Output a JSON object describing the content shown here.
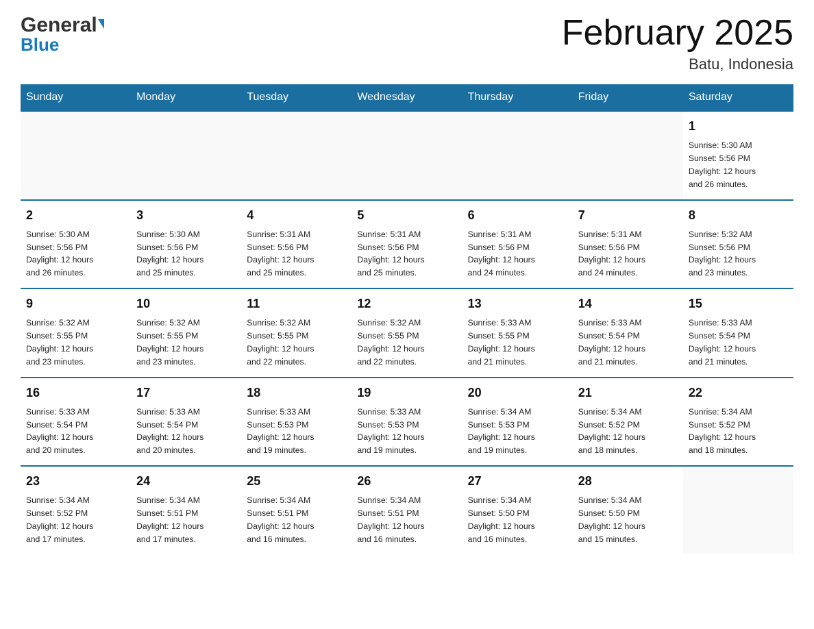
{
  "header": {
    "logo_general": "General",
    "logo_blue": "Blue",
    "month_title": "February 2025",
    "location": "Batu, Indonesia"
  },
  "weekdays": [
    "Sunday",
    "Monday",
    "Tuesday",
    "Wednesday",
    "Thursday",
    "Friday",
    "Saturday"
  ],
  "weeks": [
    [
      {
        "day": "",
        "info": ""
      },
      {
        "day": "",
        "info": ""
      },
      {
        "day": "",
        "info": ""
      },
      {
        "day": "",
        "info": ""
      },
      {
        "day": "",
        "info": ""
      },
      {
        "day": "",
        "info": ""
      },
      {
        "day": "1",
        "info": "Sunrise: 5:30 AM\nSunset: 5:56 PM\nDaylight: 12 hours\nand 26 minutes."
      }
    ],
    [
      {
        "day": "2",
        "info": "Sunrise: 5:30 AM\nSunset: 5:56 PM\nDaylight: 12 hours\nand 26 minutes."
      },
      {
        "day": "3",
        "info": "Sunrise: 5:30 AM\nSunset: 5:56 PM\nDaylight: 12 hours\nand 25 minutes."
      },
      {
        "day": "4",
        "info": "Sunrise: 5:31 AM\nSunset: 5:56 PM\nDaylight: 12 hours\nand 25 minutes."
      },
      {
        "day": "5",
        "info": "Sunrise: 5:31 AM\nSunset: 5:56 PM\nDaylight: 12 hours\nand 25 minutes."
      },
      {
        "day": "6",
        "info": "Sunrise: 5:31 AM\nSunset: 5:56 PM\nDaylight: 12 hours\nand 24 minutes."
      },
      {
        "day": "7",
        "info": "Sunrise: 5:31 AM\nSunset: 5:56 PM\nDaylight: 12 hours\nand 24 minutes."
      },
      {
        "day": "8",
        "info": "Sunrise: 5:32 AM\nSunset: 5:56 PM\nDaylight: 12 hours\nand 23 minutes."
      }
    ],
    [
      {
        "day": "9",
        "info": "Sunrise: 5:32 AM\nSunset: 5:55 PM\nDaylight: 12 hours\nand 23 minutes."
      },
      {
        "day": "10",
        "info": "Sunrise: 5:32 AM\nSunset: 5:55 PM\nDaylight: 12 hours\nand 23 minutes."
      },
      {
        "day": "11",
        "info": "Sunrise: 5:32 AM\nSunset: 5:55 PM\nDaylight: 12 hours\nand 22 minutes."
      },
      {
        "day": "12",
        "info": "Sunrise: 5:32 AM\nSunset: 5:55 PM\nDaylight: 12 hours\nand 22 minutes."
      },
      {
        "day": "13",
        "info": "Sunrise: 5:33 AM\nSunset: 5:55 PM\nDaylight: 12 hours\nand 21 minutes."
      },
      {
        "day": "14",
        "info": "Sunrise: 5:33 AM\nSunset: 5:54 PM\nDaylight: 12 hours\nand 21 minutes."
      },
      {
        "day": "15",
        "info": "Sunrise: 5:33 AM\nSunset: 5:54 PM\nDaylight: 12 hours\nand 21 minutes."
      }
    ],
    [
      {
        "day": "16",
        "info": "Sunrise: 5:33 AM\nSunset: 5:54 PM\nDaylight: 12 hours\nand 20 minutes."
      },
      {
        "day": "17",
        "info": "Sunrise: 5:33 AM\nSunset: 5:54 PM\nDaylight: 12 hours\nand 20 minutes."
      },
      {
        "day": "18",
        "info": "Sunrise: 5:33 AM\nSunset: 5:53 PM\nDaylight: 12 hours\nand 19 minutes."
      },
      {
        "day": "19",
        "info": "Sunrise: 5:33 AM\nSunset: 5:53 PM\nDaylight: 12 hours\nand 19 minutes."
      },
      {
        "day": "20",
        "info": "Sunrise: 5:34 AM\nSunset: 5:53 PM\nDaylight: 12 hours\nand 19 minutes."
      },
      {
        "day": "21",
        "info": "Sunrise: 5:34 AM\nSunset: 5:52 PM\nDaylight: 12 hours\nand 18 minutes."
      },
      {
        "day": "22",
        "info": "Sunrise: 5:34 AM\nSunset: 5:52 PM\nDaylight: 12 hours\nand 18 minutes."
      }
    ],
    [
      {
        "day": "23",
        "info": "Sunrise: 5:34 AM\nSunset: 5:52 PM\nDaylight: 12 hours\nand 17 minutes."
      },
      {
        "day": "24",
        "info": "Sunrise: 5:34 AM\nSunset: 5:51 PM\nDaylight: 12 hours\nand 17 minutes."
      },
      {
        "day": "25",
        "info": "Sunrise: 5:34 AM\nSunset: 5:51 PM\nDaylight: 12 hours\nand 16 minutes."
      },
      {
        "day": "26",
        "info": "Sunrise: 5:34 AM\nSunset: 5:51 PM\nDaylight: 12 hours\nand 16 minutes."
      },
      {
        "day": "27",
        "info": "Sunrise: 5:34 AM\nSunset: 5:50 PM\nDaylight: 12 hours\nand 16 minutes."
      },
      {
        "day": "28",
        "info": "Sunrise: 5:34 AM\nSunset: 5:50 PM\nDaylight: 12 hours\nand 15 minutes."
      },
      {
        "day": "",
        "info": ""
      }
    ]
  ]
}
